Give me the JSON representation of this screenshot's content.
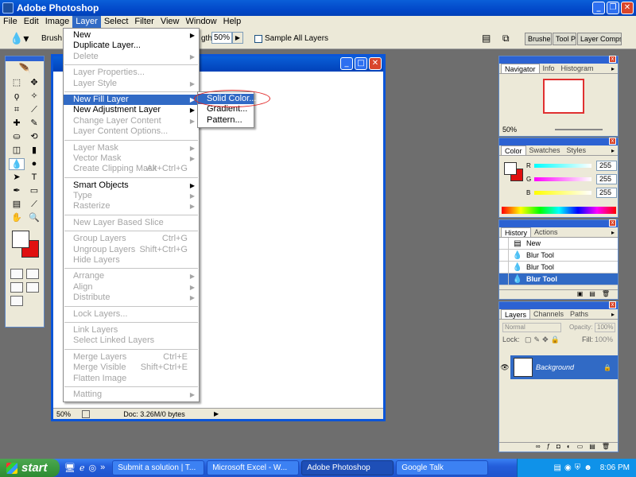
{
  "app": {
    "title": "Adobe Photoshop"
  },
  "menubar": [
    "File",
    "Edit",
    "Image",
    "Layer",
    "Select",
    "Filter",
    "View",
    "Window",
    "Help"
  ],
  "options": {
    "brush_label": "Brush:",
    "strength_label": "gth:",
    "strength_value": "50%",
    "sample_all": "Sample All Layers"
  },
  "wells": [
    "Brushe",
    "Tool Pr",
    "Layer Comps"
  ],
  "layer_menu": {
    "items": [
      {
        "label": "New",
        "enabled": true,
        "submenu": true
      },
      {
        "label": "Duplicate Layer...",
        "enabled": true
      },
      {
        "label": "Delete",
        "enabled": false,
        "submenu": true
      },
      {
        "sep": true
      },
      {
        "label": "Layer Properties...",
        "enabled": false
      },
      {
        "label": "Layer Style",
        "enabled": false,
        "submenu": true
      },
      {
        "sep": true
      },
      {
        "label": "New Fill Layer",
        "enabled": true,
        "submenu": true,
        "highlighted": true
      },
      {
        "label": "New Adjustment Layer",
        "enabled": true,
        "submenu": true
      },
      {
        "label": "Change Layer Content",
        "enabled": false,
        "submenu": true
      },
      {
        "label": "Layer Content Options...",
        "enabled": false
      },
      {
        "sep": true
      },
      {
        "label": "Layer Mask",
        "enabled": false,
        "submenu": true
      },
      {
        "label": "Vector Mask",
        "enabled": false,
        "submenu": true
      },
      {
        "label": "Create Clipping Mask",
        "enabled": false,
        "shortcut": "Alt+Ctrl+G"
      },
      {
        "sep": true
      },
      {
        "label": "Smart Objects",
        "enabled": true,
        "submenu": true
      },
      {
        "label": "Type",
        "enabled": false,
        "submenu": true
      },
      {
        "label": "Rasterize",
        "enabled": false,
        "submenu": true
      },
      {
        "sep": true
      },
      {
        "label": "New Layer Based Slice",
        "enabled": false
      },
      {
        "sep": true
      },
      {
        "label": "Group Layers",
        "enabled": false,
        "shortcut": "Ctrl+G"
      },
      {
        "label": "Ungroup Layers",
        "enabled": false,
        "shortcut": "Shift+Ctrl+G"
      },
      {
        "label": "Hide Layers",
        "enabled": false
      },
      {
        "sep": true
      },
      {
        "label": "Arrange",
        "enabled": false,
        "submenu": true
      },
      {
        "label": "Align",
        "enabled": false,
        "submenu": true
      },
      {
        "label": "Distribute",
        "enabled": false,
        "submenu": true
      },
      {
        "sep": true
      },
      {
        "label": "Lock Layers...",
        "enabled": false
      },
      {
        "sep": true
      },
      {
        "label": "Link Layers",
        "enabled": false
      },
      {
        "label": "Select Linked Layers",
        "enabled": false
      },
      {
        "sep": true
      },
      {
        "label": "Merge Layers",
        "enabled": false,
        "shortcut": "Ctrl+E"
      },
      {
        "label": "Merge Visible",
        "enabled": false,
        "shortcut": "Shift+Ctrl+E"
      },
      {
        "label": "Flatten Image",
        "enabled": false
      },
      {
        "sep": true
      },
      {
        "label": "Matting",
        "enabled": false,
        "submenu": true
      }
    ]
  },
  "fill_submenu": [
    "Solid Color...",
    "Gradient...",
    "Pattern..."
  ],
  "document": {
    "zoom": "50%",
    "doc_info": "Doc: 3.26M/0 bytes"
  },
  "navigator": {
    "tabs": [
      "Navigator",
      "Info",
      "Histogram"
    ],
    "zoom": "50%"
  },
  "color": {
    "tabs": [
      "Color",
      "Swatches",
      "Styles"
    ],
    "channels": [
      {
        "label": "R",
        "value": "255",
        "gradient": "linear-gradient(90deg,#0ff,#fff)"
      },
      {
        "label": "G",
        "value": "255",
        "gradient": "linear-gradient(90deg,#f0f,#fff)"
      },
      {
        "label": "B",
        "value": "255",
        "gradient": "linear-gradient(90deg,#ff0,#fff)"
      }
    ]
  },
  "history": {
    "tabs": [
      "History",
      "Actions"
    ],
    "items": [
      {
        "label": "New",
        "icon": "document-icon"
      },
      {
        "label": "Blur Tool",
        "icon": "drop-icon"
      },
      {
        "label": "Blur Tool",
        "icon": "drop-icon"
      },
      {
        "label": "Blur Tool",
        "icon": "drop-icon",
        "selected": true
      }
    ]
  },
  "layers": {
    "tabs": [
      "Layers",
      "Channels",
      "Paths"
    ],
    "blend_mode": "Normal",
    "opacity_label": "Opacity:",
    "opacity": "100%",
    "lock_label": "Lock:",
    "fill_label": "Fill:",
    "fill": "100%",
    "layer_name": "Background"
  },
  "taskbar": {
    "start": "start",
    "tasks": [
      {
        "label": "Submit a solution | T...",
        "active": false
      },
      {
        "label": "Microsoft Excel - W...",
        "active": false
      },
      {
        "label": "Adobe Photoshop",
        "active": true
      },
      {
        "label": "Google Talk",
        "active": false
      }
    ],
    "clock": "8:06 PM"
  },
  "colors": {
    "accent": "#316ac5",
    "title_blue": "#0248c9",
    "bg_swatch": "#e01010"
  }
}
